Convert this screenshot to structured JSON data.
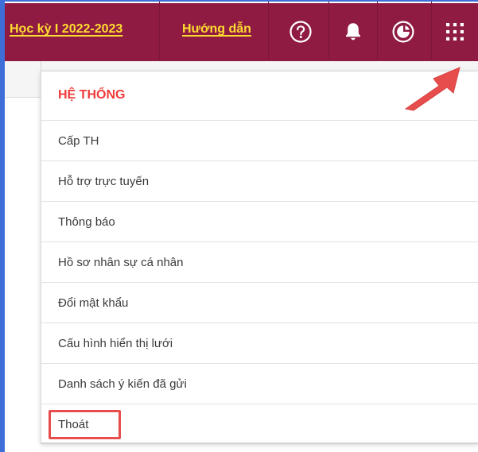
{
  "topbar": {
    "semester_link": "Học kỳ I 2022-2023",
    "guide_link": "Hướng dẫn",
    "icons": {
      "help": "question-circle-icon",
      "notification": "bell-icon",
      "chart": "pie-chart-icon",
      "apps": "grid-icon"
    }
  },
  "dropdown": {
    "section_title": "HỆ THỐNG",
    "items": [
      "Cấp TH",
      "Hỗ trợ trực tuyến",
      "Thông báo",
      "Hồ sơ nhân sự cá nhân",
      "Đổi mật khẩu",
      "Cấu hình hiển thị lưới",
      "Danh sách ý kiến đã gửi",
      "Thoát"
    ]
  },
  "colors": {
    "topbar": "#8f1b43",
    "link": "#ffde2f",
    "section_title": "#ef3b3b",
    "highlight": "#e74d4d",
    "arrow": "#e74d4d"
  }
}
